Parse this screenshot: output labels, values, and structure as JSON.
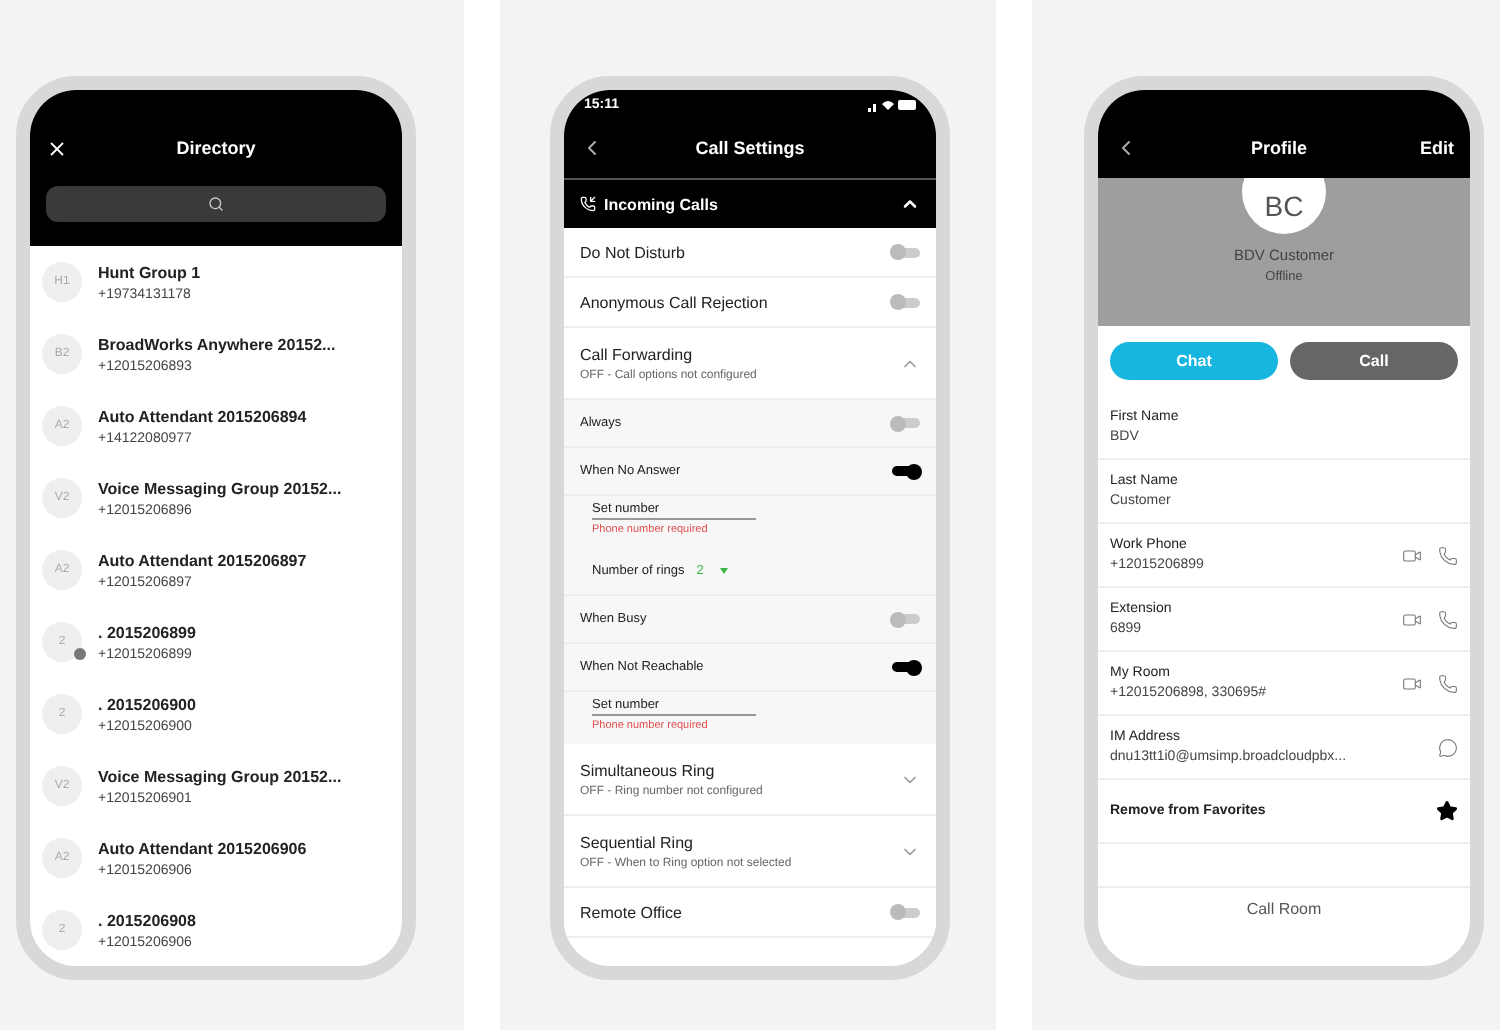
{
  "directory": {
    "title": "Directory",
    "contacts": [
      {
        "initials": "H1",
        "name": "Hunt Group 1",
        "number": "+19734131178",
        "presence_dot": false
      },
      {
        "initials": "B2",
        "name": "BroadWorks Anywhere 20152...",
        "number": "+12015206893",
        "presence_dot": false
      },
      {
        "initials": "A2",
        "name": "Auto Attendant 2015206894",
        "number": "+14122080977",
        "presence_dot": false
      },
      {
        "initials": "V2",
        "name": "Voice Messaging Group 20152...",
        "number": "+12015206896",
        "presence_dot": false
      },
      {
        "initials": "A2",
        "name": "Auto Attendant 2015206897",
        "number": "+12015206897",
        "presence_dot": false
      },
      {
        "initials": "2",
        "name": ". 2015206899",
        "number": "+12015206899",
        "presence_dot": true
      },
      {
        "initials": "2",
        "name": ". 2015206900",
        "number": "+12015206900",
        "presence_dot": false
      },
      {
        "initials": "V2",
        "name": "Voice Messaging Group 20152...",
        "number": "+12015206901",
        "presence_dot": false
      },
      {
        "initials": "A2",
        "name": "Auto Attendant 2015206906",
        "number": "+12015206906",
        "presence_dot": false
      },
      {
        "initials": "2",
        "name": ". 2015206908",
        "number": "+12015206906",
        "presence_dot": false
      }
    ]
  },
  "call_settings": {
    "time": "15:11",
    "title": "Call Settings",
    "section": {
      "label": "Incoming Calls",
      "expanded": true
    },
    "items": [
      {
        "kind": "toggle",
        "label": "Do Not Disturb",
        "on": false
      },
      {
        "kind": "toggle",
        "label": "Anonymous Call Rejection",
        "on": false
      },
      {
        "kind": "expander",
        "label": "Call Forwarding",
        "subtitle": "OFF - Call options not configured",
        "expanded": true,
        "options": [
          {
            "kind": "toggle",
            "label": "Always",
            "on": false
          },
          {
            "kind": "toggle",
            "label": "When No Answer",
            "on": true
          },
          {
            "kind": "field",
            "placeholder": "Set number",
            "error": "Phone number required"
          },
          {
            "kind": "rings",
            "label": "Number of rings",
            "value": "2"
          },
          {
            "kind": "toggle",
            "label": "When Busy",
            "on": false
          },
          {
            "kind": "toggle",
            "label": "When Not Reachable",
            "on": true
          },
          {
            "kind": "field",
            "placeholder": "Set number",
            "error": "Phone number required"
          }
        ]
      },
      {
        "kind": "expander",
        "label": "Simultaneous Ring",
        "subtitle": "OFF - Ring number not configured",
        "expanded": false
      },
      {
        "kind": "expander",
        "label": "Sequential Ring",
        "subtitle": "OFF - When to Ring option not selected",
        "expanded": false
      },
      {
        "kind": "toggle",
        "label": "Remote Office",
        "on": false
      }
    ]
  },
  "profile": {
    "title": "Profile",
    "edit": "Edit",
    "initials": "BC",
    "name": "BDV Customer",
    "status": "Offline",
    "buttons": [
      "Chat",
      "Call"
    ],
    "fields": [
      {
        "kind": "plain",
        "label": "First Name",
        "value": "BDV"
      },
      {
        "kind": "plain",
        "label": "Last Name",
        "value": "Customer"
      },
      {
        "kind": "phone",
        "label": "Work Phone",
        "value": "+12015206899"
      },
      {
        "kind": "phone",
        "label": "Extension",
        "value": "6899"
      },
      {
        "kind": "phone",
        "label": "My Room",
        "value": "+12015206898, 330695#"
      },
      {
        "kind": "im",
        "label": "IM Address",
        "value": "dnu13tt1i0@umsimp.broadcloudpbx..."
      },
      {
        "kind": "favorite",
        "label": "Remove from Favorites"
      }
    ],
    "footer": "Call Room"
  }
}
